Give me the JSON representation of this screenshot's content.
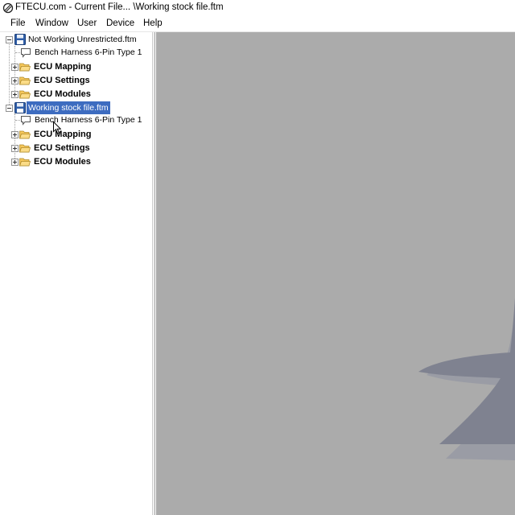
{
  "window": {
    "title": "FTECU.com - Current File... \\Working stock file.ftm",
    "app_icon": "ftecu-logo-icon"
  },
  "menu": {
    "items": [
      {
        "label": "File"
      },
      {
        "label": "Window"
      },
      {
        "label": "User"
      },
      {
        "label": "Device"
      },
      {
        "label": "Help"
      }
    ]
  },
  "tree": {
    "files": [
      {
        "name": "Not Working Unrestricted.ftm",
        "icon": "floppy-disk-icon",
        "expanded": true,
        "selected": false,
        "device": {
          "label": "Bench Harness 6-Pin Type 1",
          "icon": "speech-bubble-icon"
        },
        "folders": [
          {
            "label": "ECU Mapping",
            "icon": "folder-icon"
          },
          {
            "label": "ECU Settings",
            "icon": "folder-icon"
          },
          {
            "label": "ECU Modules",
            "icon": "folder-icon"
          }
        ]
      },
      {
        "name": "Working stock file.ftm",
        "icon": "floppy-disk-icon",
        "expanded": true,
        "selected": true,
        "device": {
          "label": "Bench Harness 6-Pin Type 1",
          "icon": "speech-bubble-icon"
        },
        "folders": [
          {
            "label": "ECU Mapping",
            "icon": "folder-icon"
          },
          {
            "label": "ECU Settings",
            "icon": "folder-icon"
          },
          {
            "label": "ECU Modules",
            "icon": "folder-icon"
          }
        ]
      }
    ]
  },
  "colors": {
    "selection": "#3d6cc0",
    "workspace": "#ababab",
    "watermark": "#7f8290",
    "folder": "#f5c75b"
  }
}
